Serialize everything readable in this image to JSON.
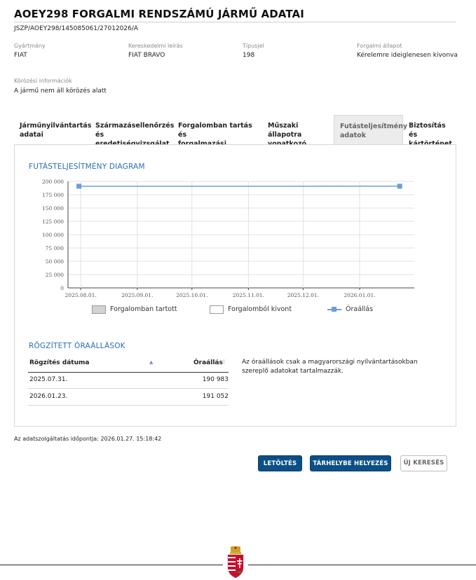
{
  "header": {
    "title": "AOEY298 FORGALMI RENDSZÁMÚ JÁRMŰ ADATAI",
    "ref_id": "JSZP/AOEY298/145085061/27012026/A"
  },
  "info": {
    "manufacturer_label": "Gyártmány",
    "manufacturer_value": "FIAT",
    "trade_label": "Kereskedelmi leírás",
    "trade_value": "FIAT BRAVO",
    "type_label": "Típusjel",
    "type_value": "198",
    "status_label": "Forgalmi állapot",
    "status_value": "Kérelemre ideiglenesen kivonva",
    "wanted_label": "Körözési információk",
    "wanted_value": "A jármű nem áll körözés alatt"
  },
  "tabs": [
    {
      "line1": "Járműnyilvántartás",
      "line2": "adatai"
    },
    {
      "line1": "Származásellenőrzés",
      "line2": "és eredetiségvizsgálat"
    },
    {
      "line1": "Forgalomban tartás és",
      "line2": "forgalmazási korlátozás"
    },
    {
      "line1": "Műszaki állapotra",
      "line2": "vonatkozó adatok"
    },
    {
      "line1": "Futásteljesítmény",
      "line2": "adatok"
    },
    {
      "line1": "Biztosítás és",
      "line2": "kártörténet"
    }
  ],
  "active_tab": 4,
  "diagram": {
    "title": "FUTÁSTELJESÍTMÉNY DIAGRAM"
  },
  "chart_data": {
    "type": "line",
    "title": "FUTÁSTELJESÍTMÉNY DIAGRAM",
    "x_ticks": [
      "2025.08.01.",
      "2025.09.01.",
      "2025.10.01.",
      "2025.11.01.",
      "2025.12.01.",
      "2026.01.01."
    ],
    "y_ticks": [
      "0",
      "25 000",
      "50 000",
      "75 000",
      "100 000",
      "125 000",
      "150 000",
      "175 000",
      "200 000"
    ],
    "ylim": [
      0,
      200000
    ],
    "xlim": [
      "2025.07.25.",
      "2026.01.31."
    ],
    "grid": true,
    "legend_position": "bottom",
    "series": [
      {
        "name": "Óraállás",
        "color": "#6a9fd8",
        "points": [
          {
            "x": "2025.07.31.",
            "y": 190983
          },
          {
            "x": "2026.01.23.",
            "y": 191052
          }
        ]
      }
    ],
    "legend": [
      {
        "label": "Forgalomban tartott",
        "kind": "box",
        "fill": "#d3d3d3"
      },
      {
        "label": "Forgalomból kivont",
        "kind": "box",
        "fill": "#ffffff"
      },
      {
        "label": "Óraállás",
        "kind": "line",
        "fill": "#6a9fd8"
      }
    ]
  },
  "records": {
    "title": "RÖGZÍTETT ÓRAÁLLÁSOK",
    "col_date": "Rögzítés dátuma",
    "col_value": "Óraállás",
    "rows": [
      {
        "date": "2025.07.31.",
        "value": "190 983"
      },
      {
        "date": "2026.01.23.",
        "value": "191 052"
      }
    ],
    "note": "Az óraállások csak a magyarországi nyilvántartásokban szereplő adatokat tartalmazzák."
  },
  "footer": {
    "timestamp": "Az adatszolgáltatás időpontja: 2026.01.27. 15:18:42"
  },
  "buttons": {
    "download": "LETÖLTÉS",
    "storage": "TÁRHELYBE HELYEZÉS",
    "new_search": "ÚJ KERESÉS"
  },
  "colors": {
    "primary_button": "#0c4f86",
    "section_title": "#2a6db8",
    "series": "#6a9fd8"
  }
}
